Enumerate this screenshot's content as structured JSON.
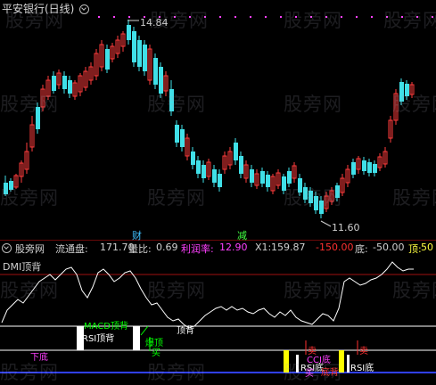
{
  "header": {
    "title": "平安银行(日线)",
    "dropdown_icon": "chevron-down-icon"
  },
  "watermark": "股旁网",
  "price_marks": {
    "high": "14.84",
    "low": "11.60"
  },
  "markers": {
    "cai": "财",
    "jian": "减"
  },
  "indicator_bar": {
    "name": "股旁网",
    "liutong_label": "流通盘:",
    "liutong_value": "171.70",
    "liangbi_label": "量比:",
    "liangbi_value": "0.69",
    "lirun_label": "利润率:",
    "lirun_value": "12.90",
    "x1_label": "X1:",
    "x1_value": "159.87",
    "neg150": "-150.00",
    "di_label": "底:",
    "di_value": "-50.00",
    "ding_label": "顶:",
    "ding_value": "50"
  },
  "indicator_labels": {
    "dmi_top": "DMI顶背",
    "macd_top": "MACD顶背",
    "rsi_top": "RSI顶背",
    "ding_bei": "顶背",
    "bao_ding": "爆顶",
    "cci_bottom": "CCI底",
    "rsi_bottom1": "RSI底",
    "rsi_bottom2": "RSI底",
    "buy1": "买",
    "buy2": "买",
    "sell1": "卖",
    "sell2": "卖",
    "bottom_div": "底背",
    "xia_di": "下底"
  },
  "colors": {
    "up": "#ff3c3c",
    "down": "#40e0e8",
    "accent_pink": "#ff40ff",
    "green": "#00ff00",
    "yellow": "#ffff00"
  }
}
